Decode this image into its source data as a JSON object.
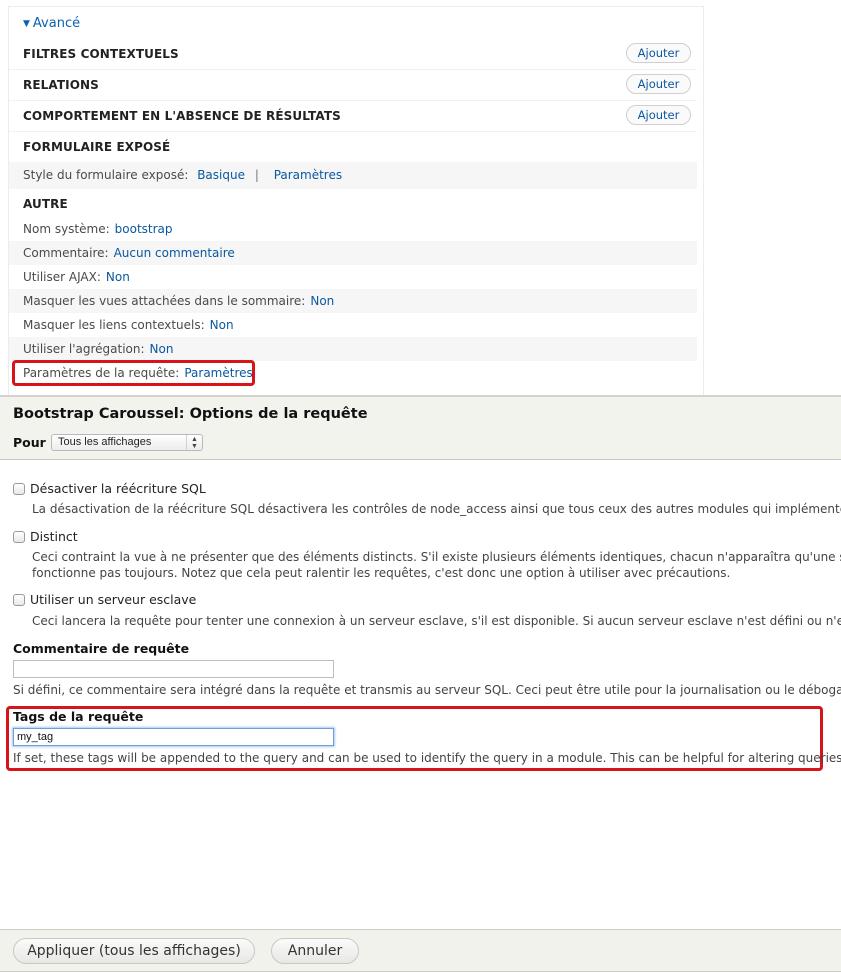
{
  "views_panel": {
    "advanced_toggle": "Avancé",
    "sections": [
      {
        "title": "FILTRES CONTEXTUELS",
        "button": "Ajouter"
      },
      {
        "title": "RELATIONS",
        "button": "Ajouter"
      },
      {
        "title": "COMPORTEMENT EN L'ABSENCE DE RÉSULTATS",
        "button": "Ajouter"
      },
      {
        "title": "FORMULAIRE EXPOSÉ"
      }
    ],
    "exposed_form": {
      "label": "Style du formulaire exposé:",
      "style_link": "Basique",
      "separator": "|",
      "settings_link": "Paramètres"
    },
    "other": {
      "title": "AUTRE",
      "settings": [
        {
          "label": "Nom système:",
          "value": "bootstrap"
        },
        {
          "label": "Commentaire:",
          "value": "Aucun commentaire"
        },
        {
          "label": "Utiliser AJAX:",
          "value": "Non"
        },
        {
          "label": "Masquer les vues attachées dans le sommaire:",
          "value": "Non"
        },
        {
          "label": "Masquer les liens contextuels:",
          "value": "Non"
        },
        {
          "label": "Utiliser l'agrégation:",
          "value": "Non"
        },
        {
          "label": "Paramètres de la requête:",
          "value": "Paramètres"
        }
      ]
    }
  },
  "modal": {
    "title": "Bootstrap Caroussel: Options de la requête",
    "for_label": "Pour",
    "for_select_value": "Tous les affichages",
    "checkboxes": [
      {
        "label": "Désactiver la réécriture SQL",
        "checked": false,
        "description": [
          "La désactivation de la réécriture SQL désactivera les contrôles de node_access ainsi que tous ceux des autres modules qui implémentent ho"
        ]
      },
      {
        "label": "Distinct",
        "checked": false,
        "description": [
          "Ceci contraint la vue à ne présenter que des éléments distincts. S'il existe plusieurs éléments identiques, chacun n'apparaîtra qu'une seule",
          "fonctionne pas toujours. Notez que cela peut ralentir les requêtes, c'est donc une option à utiliser avec précautions."
        ]
      },
      {
        "label": "Utiliser un serveur esclave",
        "checked": false,
        "description": [
          "Ceci lancera la requête pour tenter une connexion à un serveur esclave, s'il est disponible. Si aucun serveur esclave n'est défini ou n'est dis"
        ]
      }
    ],
    "query_comment": {
      "label": "Commentaire de requête",
      "value": "",
      "help": "Si défini, ce commentaire sera intégré dans la requête et transmis au serveur SQL. Ceci peut être utile pour la journalisation ou le débogage."
    },
    "query_tags": {
      "label": "Tags de la requête",
      "value": "my_tag",
      "help": "If set, these tags will be appended to the query and can be used to identify the query in a module. This can be helpful for altering queries."
    },
    "buttons": {
      "apply": "Appliquer (tous les affichages)",
      "cancel": "Annuler"
    }
  },
  "colors": {
    "link": "#0a58a0",
    "highlight": "#d7141a",
    "modal_bar": "#f3f3ee"
  }
}
